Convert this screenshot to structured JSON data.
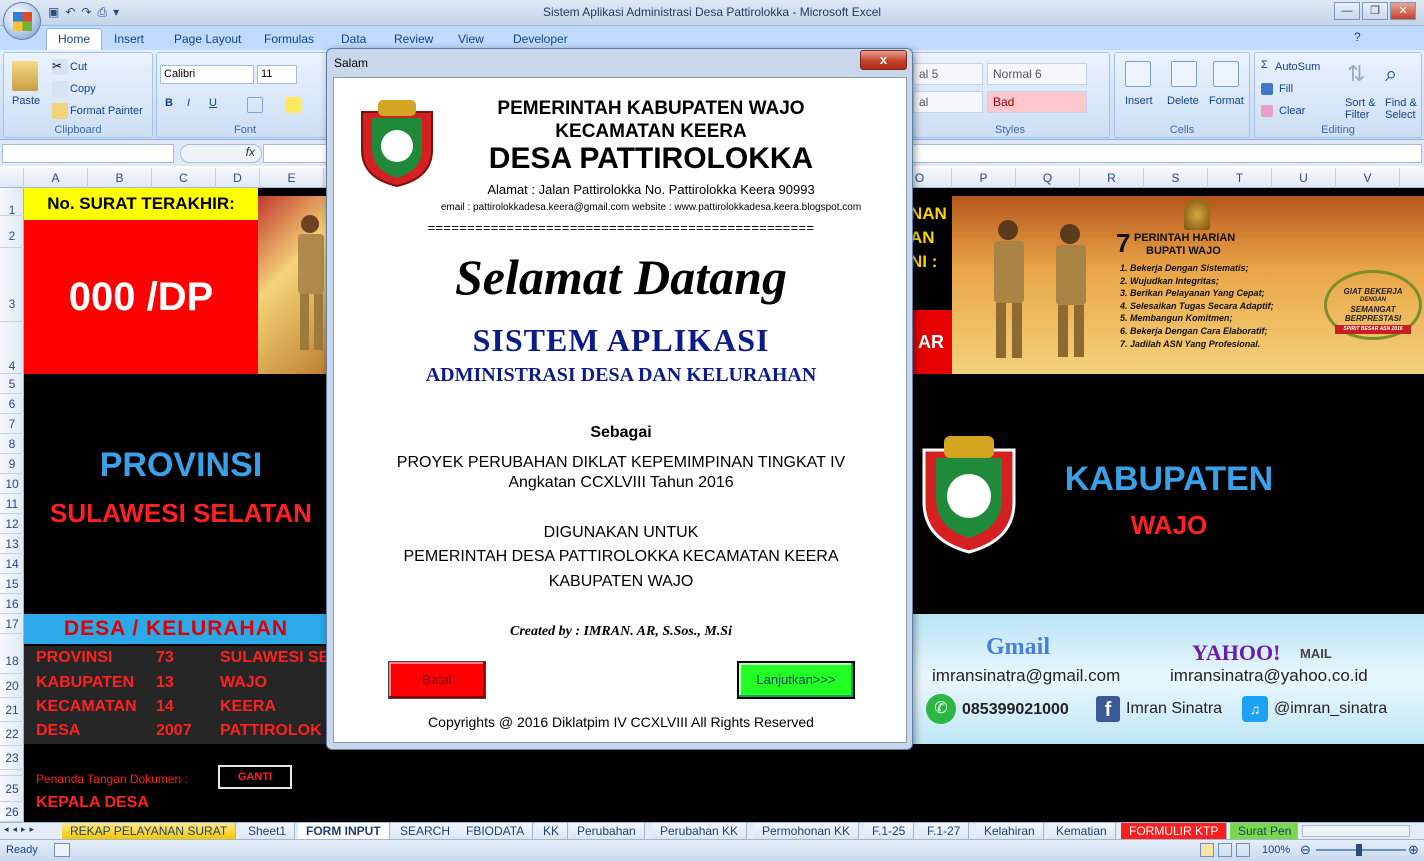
{
  "window": {
    "title": "Sistem Aplikasi Administrasi Desa Pattirolokka - Microsoft Excel"
  },
  "ribbon": {
    "tabs": [
      "Home",
      "Insert",
      "Page Layout",
      "Formulas",
      "Data",
      "Review",
      "View",
      "Developer"
    ],
    "clipboard": {
      "paste": "Paste",
      "cut": "Cut",
      "copy": "Copy",
      "format_painter": "Format Painter",
      "group": "Clipboard"
    },
    "font": {
      "name": "Calibri",
      "size": "11",
      "group": "Font"
    },
    "styles": {
      "s1": "al 5",
      "s2": "Normal 6",
      "s3": "al",
      "s4": "Bad",
      "group": "Styles"
    },
    "cells": {
      "insert": "Insert",
      "delete": "Delete",
      "format": "Format",
      "group": "Cells"
    },
    "editing": {
      "autosum": "AutoSum",
      "fill": "Fill",
      "clear": "Clear",
      "sort": "Sort &",
      "filter": "Filter",
      "find": "Find &",
      "select": "Select",
      "group": "Editing"
    }
  },
  "formula_bar": {
    "fx": "fx"
  },
  "columns": [
    "A",
    "B",
    "C",
    "D",
    "E",
    "O",
    "P",
    "Q",
    "R",
    "S",
    "T",
    "U",
    "V"
  ],
  "rows": [
    "1",
    "2",
    "3",
    "4",
    "5",
    "6",
    "7",
    "8",
    "9",
    "10",
    "11",
    "12",
    "13",
    "14",
    "15",
    "16",
    "17",
    "18",
    "20",
    "21",
    "22",
    "23",
    "24",
    "25",
    "26"
  ],
  "sheet": {
    "no_surat_label": "No. SURAT TERAKHIR:",
    "no_surat_value": "000 /DP",
    "provinsi_title": "PROVINSI",
    "provinsi_name": "SULAWESI SELATAN",
    "kabupaten_title": "KABUPATEN",
    "kabupaten_name": "WAJO",
    "desa_header": "DESA / KELURAHAN",
    "table": [
      {
        "label": "PROVINSI",
        "code": "73",
        "name": "SULAWESI SE"
      },
      {
        "label": "KABUPATEN",
        "code": "13",
        "name": "WAJO"
      },
      {
        "label": "KECAMATAN",
        "code": "14",
        "name": "KEERA"
      },
      {
        "label": "DESA",
        "code": "2007",
        "name": "PATTIROLOK"
      }
    ],
    "penanda_label": "Penanda Tangan Dokumen :",
    "ganti_button": "GANTI",
    "kepala_desa": "KEPALA DESA",
    "banner_partial": [
      "NAN",
      "AN",
      "NI :"
    ],
    "banner_ar": "AR",
    "perintah": {
      "title_num": "7",
      "title1": "PERINTAH HARIAN",
      "title2": "BUPATI WAJO",
      "items": [
        "1. Bekerja Dengan Sistematis;",
        "2. Wujudkan Integritas;",
        "3. Berikan Pelayanan Yang Cepat;",
        "4. Selesaikan Tugas Secara Adaptif;",
        "5. Membangun Komitmen;",
        "6. Bekerja Dengan Cara Elaboratif;",
        "7. Jadilah ASN Yang Profesional."
      ],
      "badge1": "GIAT BEKERJA",
      "badge2": "DENGAN",
      "badge3": "SEMANGAT",
      "badge4": "BERPRESTASI",
      "badge5": "SPIRIT BESAR ASN 2016"
    },
    "contact": {
      "gmail_logo": "Gmail",
      "gmail": "imransinatra@gmail.com",
      "yahoo_logo": "YAHOO!",
      "yahoo_mail": "MAIL",
      "yahoo": "imransinatra@yahoo.co.id",
      "phone": "085399021000",
      "facebook": "Imran Sinatra",
      "twitter": "@imran_sinatra"
    }
  },
  "sheet_tabs": [
    "REKAP PELAYANAN SURAT",
    "Sheet1",
    "FORM INPUT",
    "SEARCH",
    "FBIODATA",
    "KK",
    "Perubahan",
    "Perubahan KK",
    "Permohonan KK",
    "F.1-25",
    "F.1-27",
    "Kelahiran",
    "Kematian",
    "FORMULIR KTP",
    "Surat Pen"
  ],
  "status": {
    "ready": "Ready",
    "zoom": "100%"
  },
  "dialog": {
    "title": "Salam",
    "close": "x",
    "header1": "PEMERINTAH KABUPATEN WAJO",
    "header2": "KECAMATAN KEERA",
    "header3": "DESA PATTIROLOKKA",
    "address": "Alamat : Jalan Pattirolokka No.    Pattirolokka Keera 90993",
    "email_web": "email : pattirolokkadesa.keera@gmail.com  website : www.pattirolokkadesa.keera.blogspot.com",
    "separator": "=================================================",
    "welcome": "Selamat Datang",
    "app_title": "SISTEM APLIKASI",
    "app_subtitle": "ADMINISTRASI DESA DAN KELURAHAN",
    "sebagai": "Sebagai",
    "proyek1": "PROYEK PERUBAHAN DIKLAT KEPEMIMPINAN TINGKAT IV",
    "proyek2": "Angkatan CCXLVIII Tahun 2016",
    "digunakan": "DIGUNAKAN UNTUK",
    "pemerintah1": "PEMERINTAH DESA PATTIROLOKKA KECAMATAN KEERA",
    "pemerintah2": "KABUPATEN WAJO",
    "created": "Created by : IMRAN. AR, S.Sos., M.Si",
    "batal": "Batal",
    "lanjutkan": "Lanjutkan>>>",
    "copyright": "Copyrights @ 2016 Diklatpim IV CCXLVIII All Rights Reserved"
  }
}
